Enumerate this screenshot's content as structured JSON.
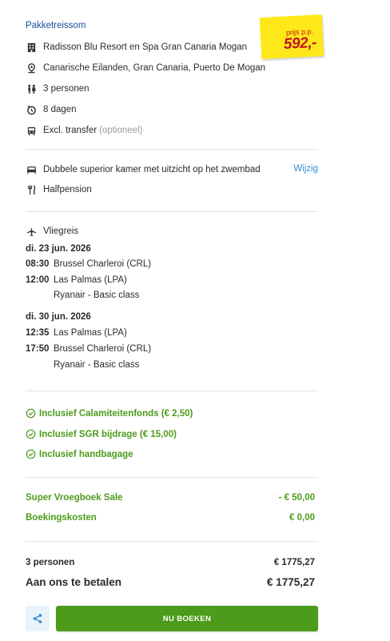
{
  "package": {
    "title": "Pakketreissom",
    "hotel": "Radisson Blu Resort en Spa Gran Canaria Mogan",
    "location": "Canarische Eilanden, Gran Canaria, Puerto De Mogan",
    "persons": "3 personen",
    "duration": "8 dagen",
    "transfer": "Excl. transfer",
    "transfer_note": "(optioneel)"
  },
  "price_sticker": {
    "label": "prijs p.p.",
    "amount": "592,-",
    "colors": {
      "paper": "#ffe81a",
      "text": "#c3151b"
    }
  },
  "room": {
    "description": "Dubbele superior kamer met uitzicht op het zwembad",
    "change_label": "Wijzig",
    "board": "Halfpension"
  },
  "flight": {
    "heading": "Vliegreis",
    "outbound": {
      "date": "di. 23 jun. 2026",
      "dep_time": "08:30",
      "dep_airport": "Brussel Charleroi (CRL)",
      "arr_time": "12:00",
      "arr_airport": "Las Palmas (LPA)",
      "carrier": "Ryanair - Basic class"
    },
    "return": {
      "date": "di. 30 jun. 2026",
      "dep_time": "12:35",
      "dep_airport": "Las Palmas (LPA)",
      "arr_time": "17:50",
      "arr_airport": "Brussel Charleroi (CRL)",
      "carrier": "Ryanair - Basic class"
    }
  },
  "inclusions": [
    "Inclusief Calamiteitenfonds (€ 2,50)",
    "Inclusief SGR bijdrage (€ 15,00)",
    "Inclusief handbagage"
  ],
  "discounts": [
    {
      "label": "Super Vroegboek Sale",
      "value": "- € 50,00"
    },
    {
      "label": "Boekingskosten",
      "value": "€ 0,00"
    }
  ],
  "summary": {
    "persons_label": "3 personen",
    "persons_value": "€ 1775,27",
    "total_label": "Aan ons te betalen",
    "total_value": "€ 1775,27"
  },
  "actions": {
    "share_icon": "share-icon",
    "book_label": "NU BOEKEN"
  },
  "colors": {
    "title_blue": "#1a4c9c",
    "link_blue": "#2f8bd6",
    "green": "#4c9b1a"
  }
}
